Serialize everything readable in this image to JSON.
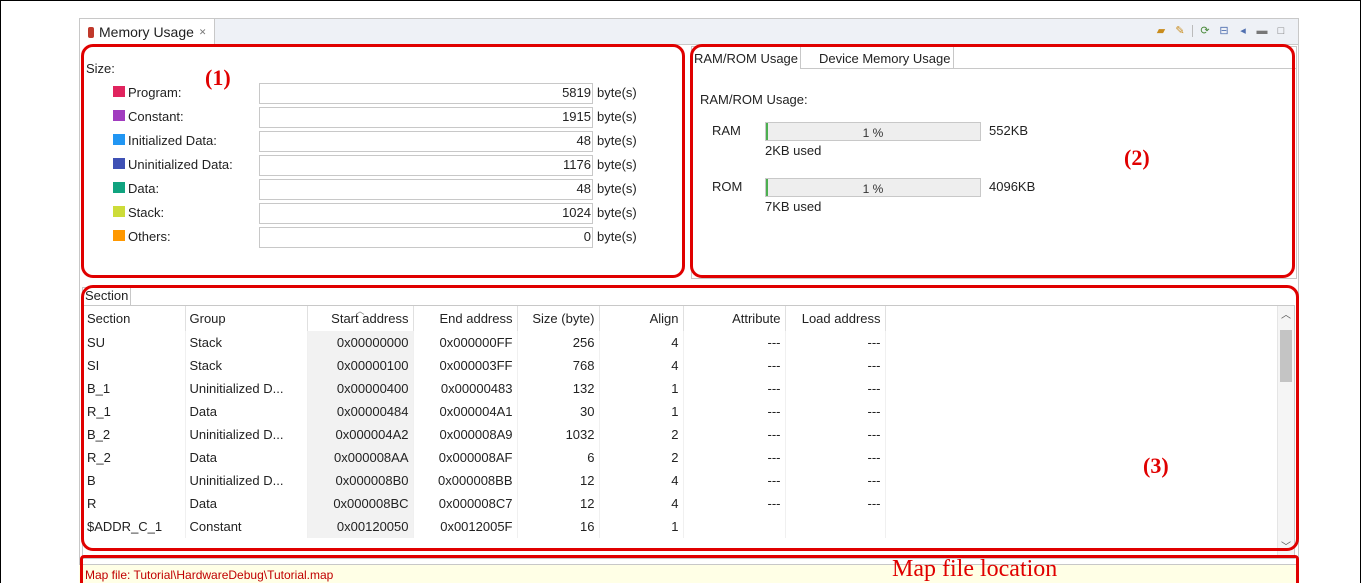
{
  "view": {
    "tab_title": "Memory Usage",
    "close_glyph": "✕",
    "toolbar_icons": [
      "export-icon",
      "edit-icon",
      "refresh-icon",
      "collapse-icon",
      "back-icon",
      "minimize-icon",
      "maximize-icon"
    ]
  },
  "size_panel": {
    "title": "Size:",
    "rows": [
      {
        "label": "Program:",
        "value": "5819",
        "unit": "byte(s)",
        "color": "#e0245e"
      },
      {
        "label": "Constant:",
        "value": "1915",
        "unit": "byte(s)",
        "color": "#a13cbf"
      },
      {
        "label": "Initialized Data:",
        "value": "48",
        "unit": "byte(s)",
        "color": "#2196f3"
      },
      {
        "label": "Uninitialized Data:",
        "value": "1176",
        "unit": "byte(s)",
        "color": "#3f51b5"
      },
      {
        "label": "Data:",
        "value": "48",
        "unit": "byte(s)",
        "color": "#10a37f"
      },
      {
        "label": "Stack:",
        "value": "1024",
        "unit": "byte(s)",
        "color": "#cddc39"
      },
      {
        "label": "Others:",
        "value": "0",
        "unit": "byte(s)",
        "color": "#ff9800"
      }
    ]
  },
  "ram_rom": {
    "tabs": [
      "RAM/ROM Usage",
      "Device Memory Usage"
    ],
    "title": "RAM/ROM Usage:",
    "items": [
      {
        "label": "RAM",
        "percent": "1 %",
        "fraction": 0.01,
        "max": "552KB",
        "used": "2KB used"
      },
      {
        "label": "ROM",
        "percent": "1 %",
        "fraction": 0.01,
        "max": "4096KB",
        "used": "7KB used"
      }
    ]
  },
  "section": {
    "tab": "Section",
    "columns": [
      "Section",
      "Group",
      "Start address",
      "End address",
      "Size (byte)",
      "Align",
      "Attribute",
      "Load address"
    ],
    "rows": [
      [
        "SU",
        "Stack",
        "0x00000000",
        "0x000000FF",
        "256",
        "4",
        "---",
        "---"
      ],
      [
        "SI",
        "Stack",
        "0x00000100",
        "0x000003FF",
        "768",
        "4",
        "---",
        "---"
      ],
      [
        "B_1",
        "Uninitialized D...",
        "0x00000400",
        "0x00000483",
        "132",
        "1",
        "---",
        "---"
      ],
      [
        "R_1",
        "Data",
        "0x00000484",
        "0x000004A1",
        "30",
        "1",
        "---",
        "---"
      ],
      [
        "B_2",
        "Uninitialized D...",
        "0x000004A2",
        "0x000008A9",
        "1032",
        "2",
        "---",
        "---"
      ],
      [
        "R_2",
        "Data",
        "0x000008AA",
        "0x000008AF",
        "6",
        "2",
        "---",
        "---"
      ],
      [
        "B",
        "Uninitialized D...",
        "0x000008B0",
        "0x000008BB",
        "12",
        "4",
        "---",
        "---"
      ],
      [
        "R",
        "Data",
        "0x000008BC",
        "0x000008C7",
        "12",
        "4",
        "---",
        "---"
      ],
      [
        "$ADDR_C_1",
        "Constant",
        "0x00120050",
        "0x0012005F",
        "16",
        "1",
        "",
        ""
      ]
    ]
  },
  "map_file": {
    "text": "Map file: Tutorial\\HardwareDebug\\Tutorial.map"
  },
  "annotations": {
    "a1": "(1)",
    "a2": "(2)",
    "a3": "(3)",
    "map_location": "Map file location"
  },
  "colors": {
    "highlight": "#e00000",
    "progress": "#4caf50"
  }
}
